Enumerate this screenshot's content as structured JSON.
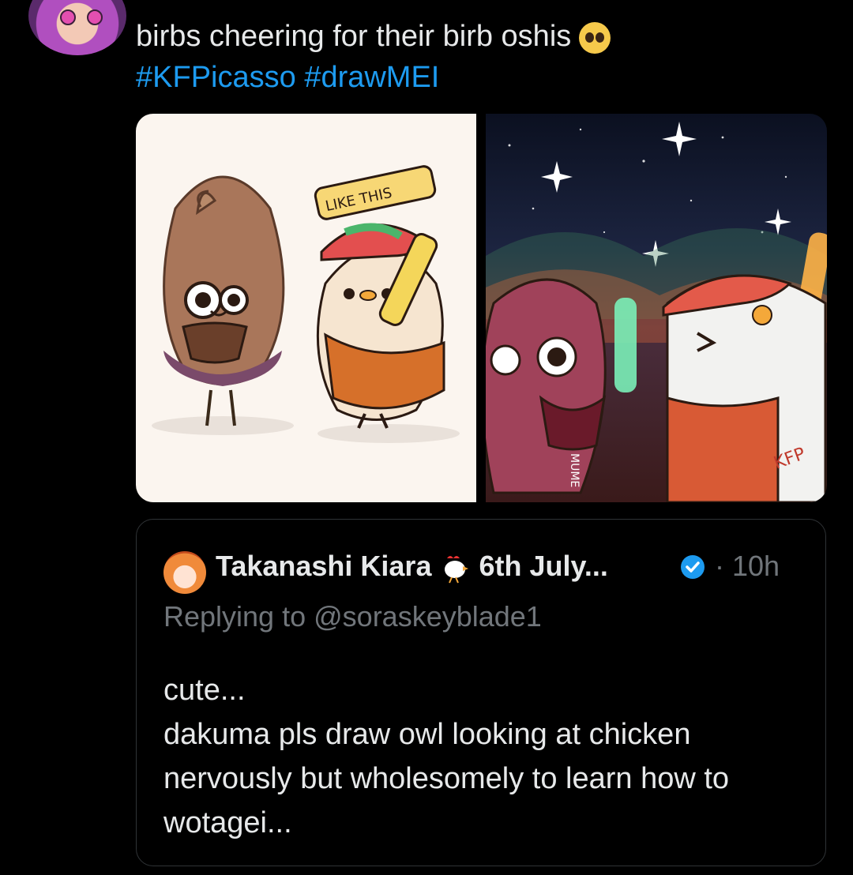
{
  "tweet": {
    "text_line1": "birbs cheering for their birb oshis",
    "hashtag1": "#KFPicasso",
    "hashtag2": "#drawMEI",
    "emoji_icon": "pleading-face-icon"
  },
  "media": {
    "left_speech_bubble": "LIKE THIS",
    "right_lightstick_text": "MUME",
    "right_sign_text": "KFP",
    "colors": {
      "hashtag": "#1d9bf0",
      "verified": "#1d9bf0",
      "muted": "#71767b"
    }
  },
  "quote": {
    "name": "Takanashi Kiara",
    "name_suffix": "6th July...",
    "time": "· 10h",
    "reply_prefix": "Replying to",
    "reply_handle": "@soraskeyblade1",
    "body": "cute...\ndakuma pls draw owl looking at chicken nervously but wholesomely to learn how to wotagei..."
  }
}
